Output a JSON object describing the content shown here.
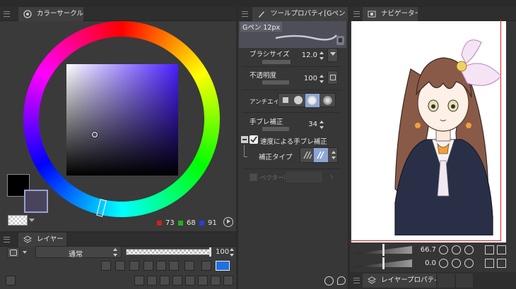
{
  "color_circle": {
    "tab_title": "カラーサークル",
    "rgb": {
      "r": "73",
      "g": "68",
      "b": "91"
    },
    "colors": {
      "main": "#000000",
      "sub": "#49445b",
      "square_hue": "#4a1eff",
      "r_dot": "#d02020",
      "g_dot": "#20b020",
      "b_dot": "#2040e0"
    }
  },
  "tool_property": {
    "tab_title": "ツールプロパティ[Gペン",
    "preset_name": "Gペン 12px",
    "brush_size": {
      "label": "ブラシサイズ",
      "value": "12.0"
    },
    "opacity": {
      "label": "不透明度",
      "value": "100"
    },
    "antialias": {
      "label": "アンチエイリ"
    },
    "stabilization": {
      "label": "手ブレ補正",
      "value": "34"
    },
    "speed_stabilization": {
      "label": "速度による手ブレ補正",
      "checked": true
    },
    "correction_type": {
      "label": "補正タイプ"
    },
    "vector_label": "ベクター吸"
  },
  "navigator": {
    "tab_title": "ナビゲーター",
    "zoom": "66.7",
    "rotation": "0.0"
  },
  "layer": {
    "tab_title": "レイヤー",
    "blend_mode": "通常",
    "opacity": "100"
  },
  "layer_property": {
    "tab_title": "レイヤープロパティ"
  }
}
